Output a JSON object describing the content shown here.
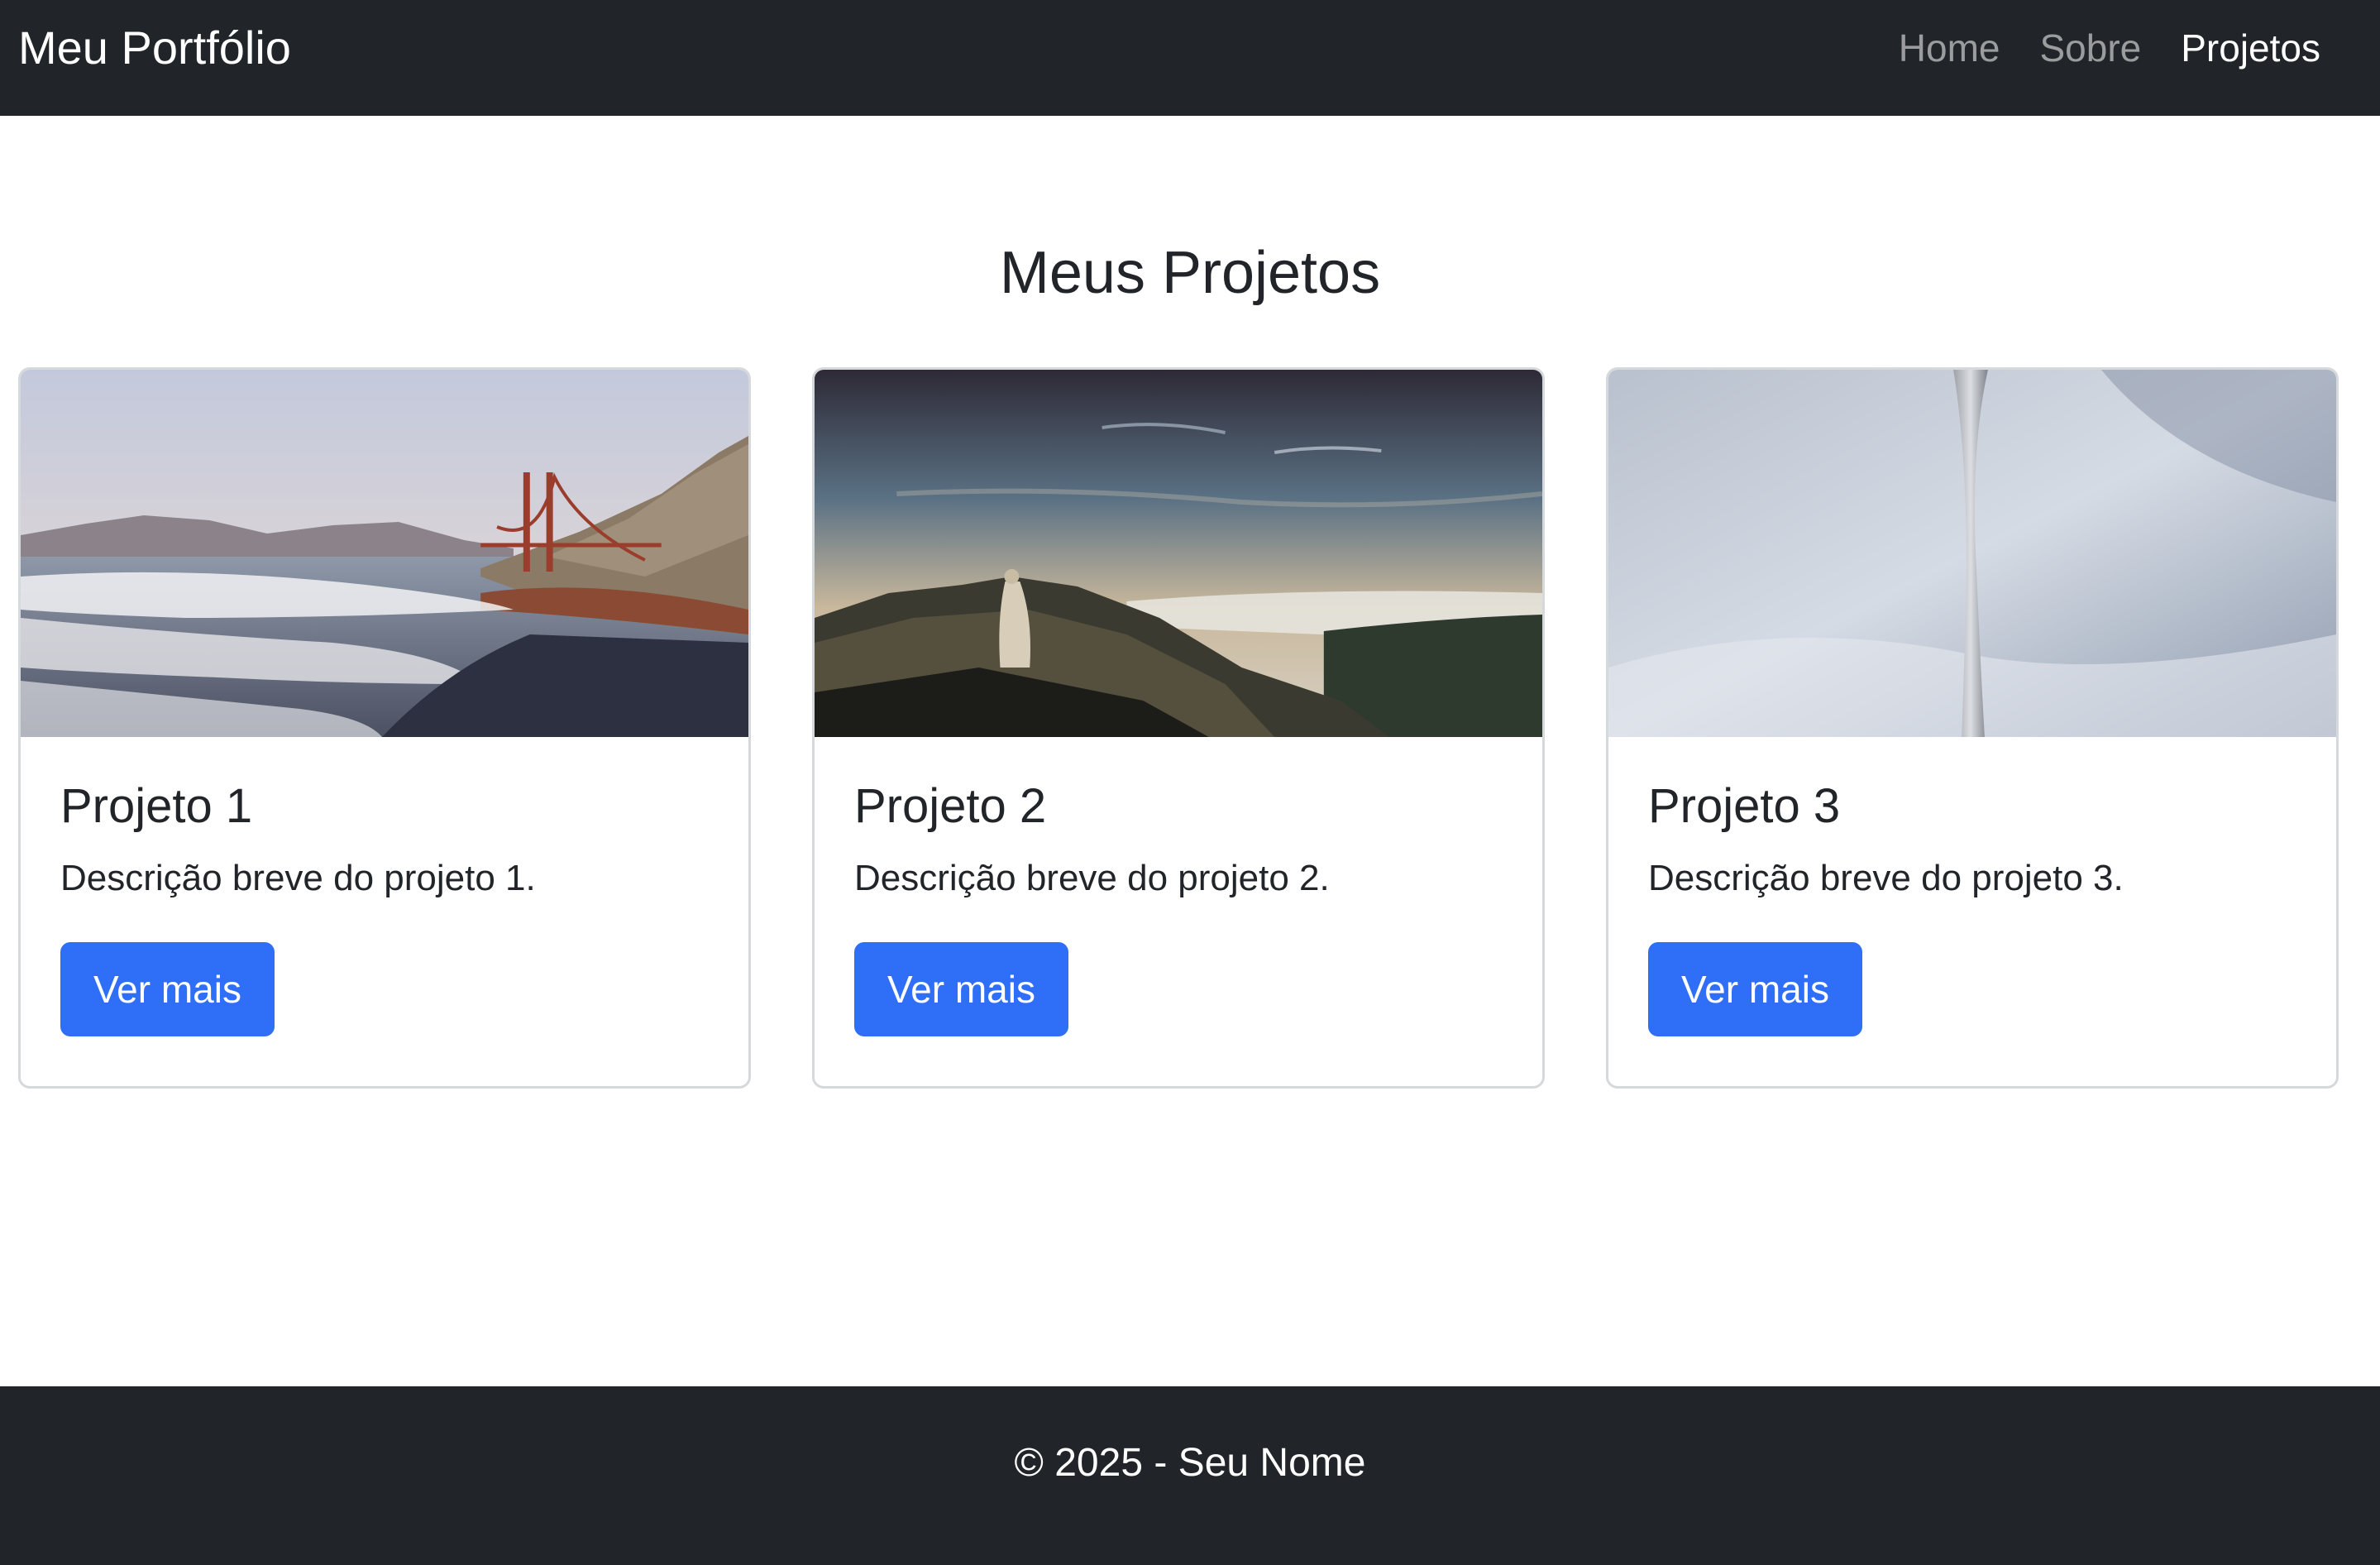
{
  "navbar": {
    "brand": "Meu Portfólio",
    "links": [
      {
        "label": "Home",
        "active": false
      },
      {
        "label": "Sobre",
        "active": false
      },
      {
        "label": "Projetos",
        "active": true
      }
    ]
  },
  "main": {
    "title": "Meus Projetos",
    "cards": [
      {
        "image": "beach-golden-gate-bridge-photo",
        "title": "Projeto 1",
        "text": "Descrição breve do projeto 1.",
        "button": "Ver mais"
      },
      {
        "image": "mountain-top-above-clouds-photo",
        "title": "Projeto 2",
        "text": "Descrição breve do projeto 2.",
        "button": "Ver mais"
      },
      {
        "image": "tall-tower-against-sky-photo",
        "title": "Projeto 3",
        "text": "Descrição breve do projeto 3.",
        "button": "Ver mais"
      }
    ]
  },
  "footer": {
    "text": "© 2025 - Seu Nome"
  },
  "colors": {
    "navbar_bg": "#212529",
    "button_bg": "#2f6ef6",
    "nav_inactive": "#8c8f92",
    "nav_active": "#ffffff"
  }
}
